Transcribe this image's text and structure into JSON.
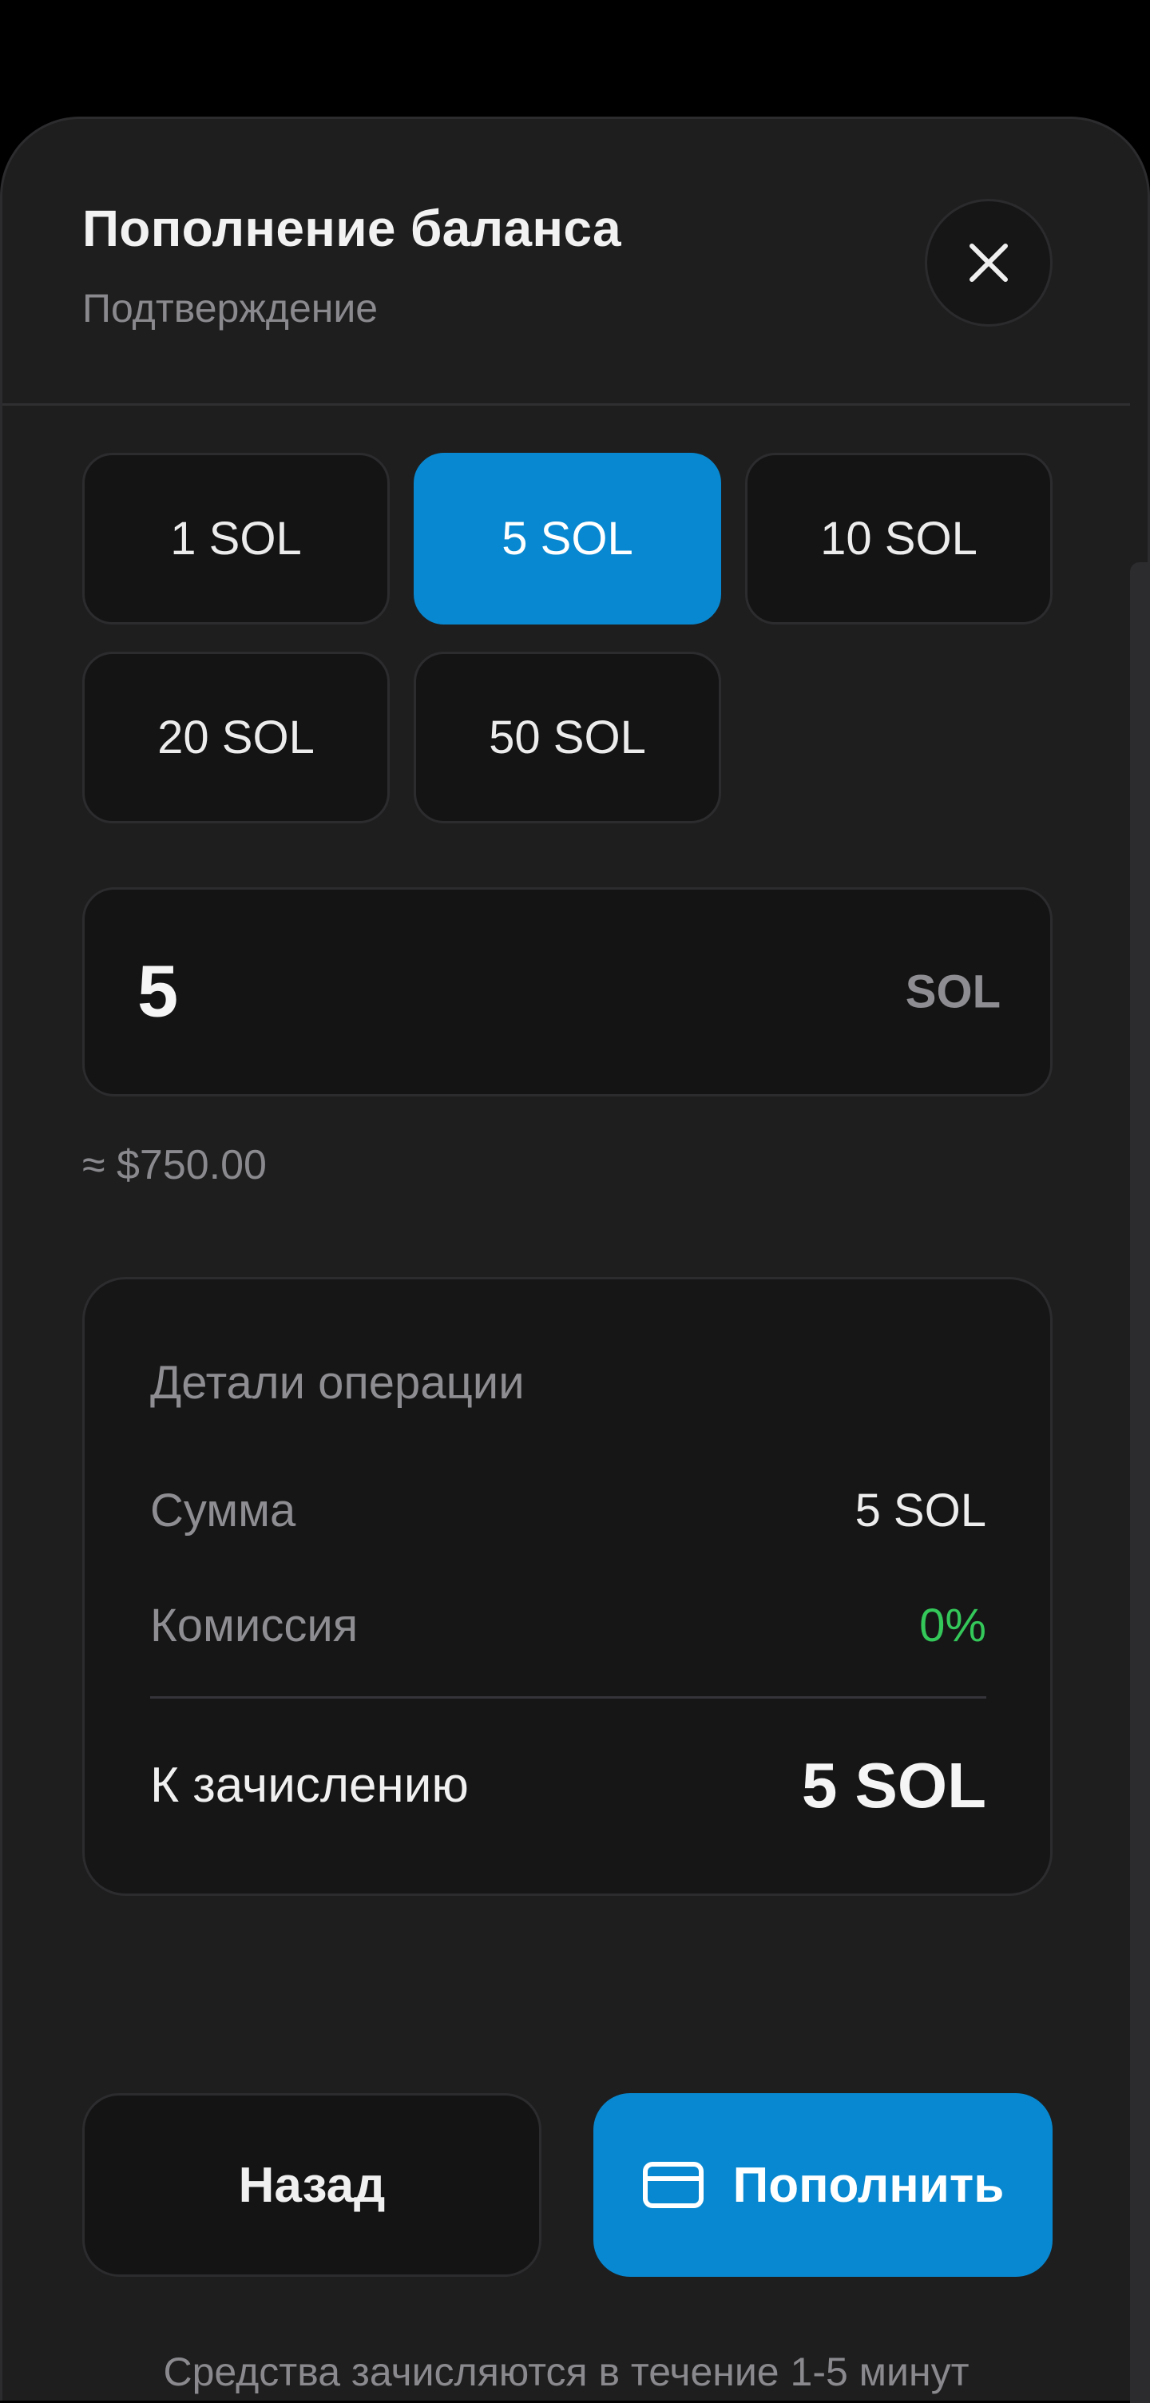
{
  "header": {
    "title": "Пополнение баланса",
    "subtitle": "Подтверждение",
    "close_icon": "close-icon"
  },
  "presets": [
    {
      "label": "1 SOL",
      "selected": false
    },
    {
      "label": "5 SOL",
      "selected": true
    },
    {
      "label": "10 SOL",
      "selected": false
    },
    {
      "label": "20 SOL",
      "selected": false
    },
    {
      "label": "50 SOL",
      "selected": false
    }
  ],
  "amount": {
    "value": "5",
    "unit": "SOL",
    "usd_approx": "≈ $750.00"
  },
  "details": {
    "title": "Детали операции",
    "sum_label": "Сумма",
    "sum_value": "5 SOL",
    "fee_label": "Комиссия",
    "fee_value": "0%",
    "total_label": "К зачислению",
    "total_value": "5 SOL"
  },
  "actions": {
    "back_label": "Назад",
    "topup_label": "Пополнить",
    "topup_icon": "credit-card-icon"
  },
  "footnote": "Средства зачисляются в течение 1-5 минут",
  "colors": {
    "accent": "#0888d0",
    "background": "#1e1e1f",
    "success": "#34c759"
  }
}
